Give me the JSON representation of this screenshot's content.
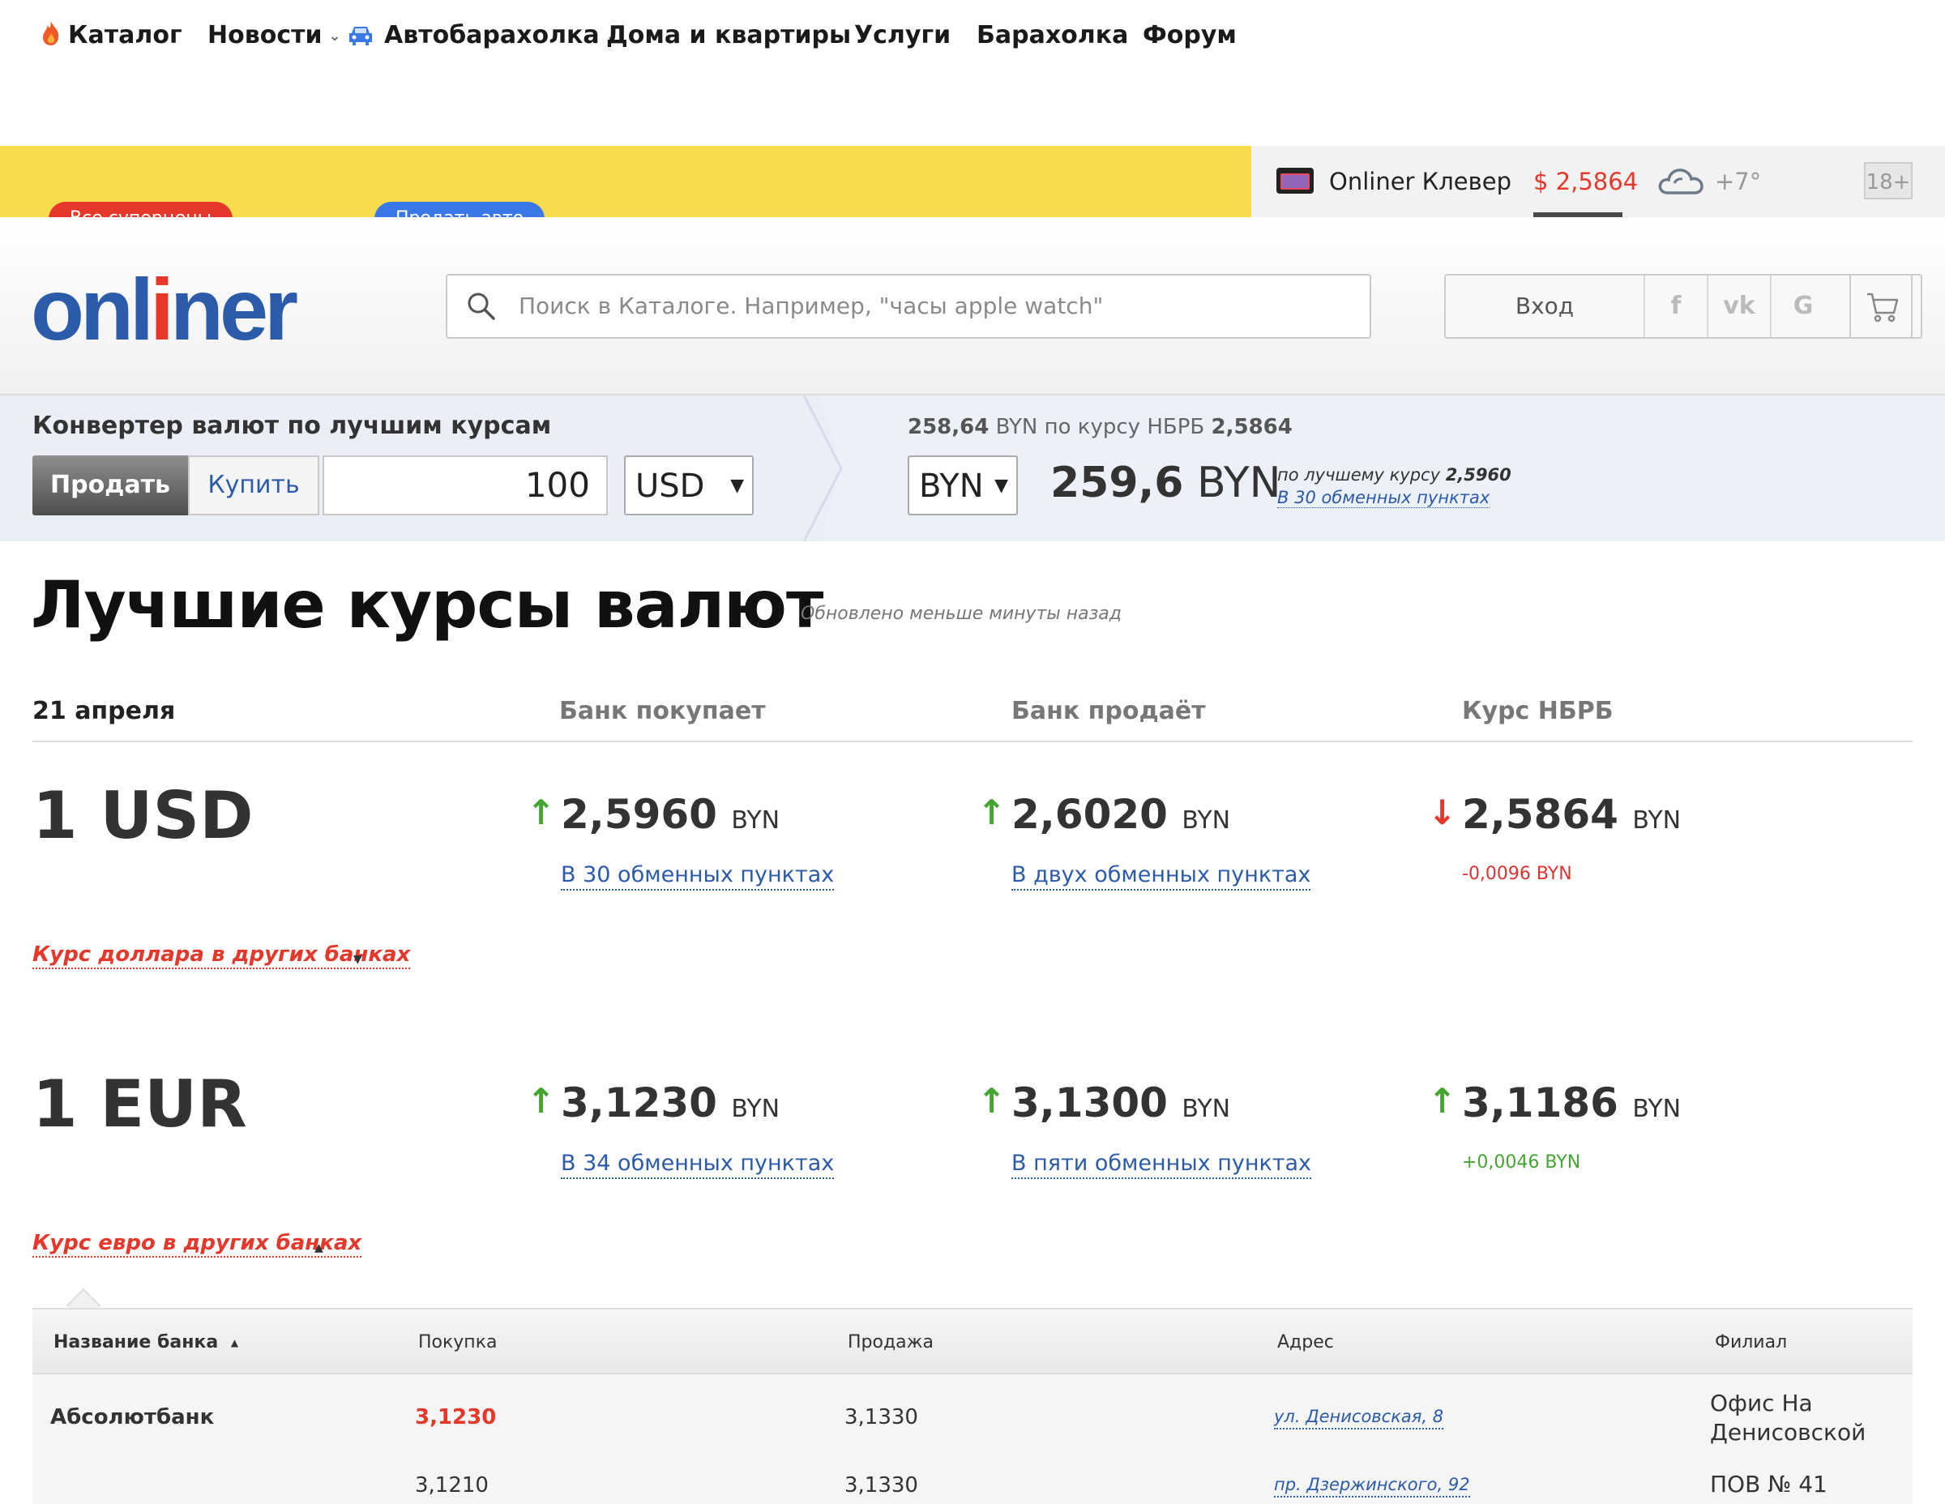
{
  "topnav": {
    "items": [
      {
        "label": "Каталог",
        "icon": "fire-icon"
      },
      {
        "label": "Новости",
        "dropdown": true
      },
      {
        "label": "Автобарахолка",
        "icon": "car-icon",
        "dropdown": true
      },
      {
        "label": "Дома и квартиры",
        "dropdown": true
      },
      {
        "label": "Услуги"
      },
      {
        "label": "Барахолка"
      },
      {
        "label": "Форум"
      }
    ],
    "badges": {
      "catalog": "Все суперцены",
      "auto": "Продать авто"
    },
    "clever": "Onliner Клевер",
    "currency": "$ 2,5864",
    "weather": "+7°",
    "age": "18+",
    "colors": {
      "nav_bg": "#f7dd4d",
      "accent_red": "#e6372b",
      "accent_blue": "#3b78e7"
    }
  },
  "header": {
    "logo_parts": [
      "onl",
      "i",
      "ner"
    ],
    "search_placeholder": "Поиск в Каталоге. Например, \"часы apple watch\"",
    "login": "Вход",
    "social": [
      "f",
      "vk",
      "G"
    ]
  },
  "converter": {
    "title": "Конвертер валют по лучшим курсам",
    "sell": "Продать",
    "buy": "Купить",
    "amount": "100",
    "from_currency": "USD",
    "to_currency": "BYN",
    "nbrb_amount": "258,64",
    "nbrb_text": "BYN по курсу НБРБ",
    "nbrb_rate": "2,5864",
    "result_value": "259,6",
    "result_unit": "BYN",
    "best_text": "по лучшему курсу",
    "best_rate": "2,5960",
    "best_link": "В 30 обменных пунктах"
  },
  "page": {
    "title": "Лучшие курсы валют",
    "updated": "Обновлено меньше минуты назад",
    "date": "21 апреля",
    "col_buy": "Банк покупает",
    "col_sell": "Банк продаёт",
    "col_nbrb": "Курс НБРБ"
  },
  "rates": [
    {
      "currency": "1 USD",
      "buy": {
        "value": "2,5960",
        "unit": "BYN",
        "trend": "up",
        "link": "В 30 обменных пунктах"
      },
      "sell": {
        "value": "2,6020",
        "unit": "BYN",
        "trend": "up",
        "link": "В двух обменных пунктах"
      },
      "nbrb": {
        "value": "2,5864",
        "unit": "BYN",
        "trend": "down",
        "delta": "-0,0096 BYN"
      },
      "banks_link": "Курс доллара в других банках"
    },
    {
      "currency": "1 EUR",
      "buy": {
        "value": "3,1230",
        "unit": "BYN",
        "trend": "up",
        "link": "В 34 обменных пунктах"
      },
      "sell": {
        "value": "3,1300",
        "unit": "BYN",
        "trend": "up",
        "link": "В пяти обменных пунктах"
      },
      "nbrb": {
        "value": "3,1186",
        "unit": "BYN",
        "trend": "up",
        "delta": "+0,0046 BYN"
      },
      "banks_link": "Курс евро в других банках"
    }
  ],
  "table": {
    "headers": [
      "Название банка",
      "Покупка",
      "Продажа",
      "Адрес",
      "Филиал"
    ],
    "rows": [
      {
        "bank": "Абсолютбанк",
        "buy": "3,1230",
        "sell": "3,1330",
        "address": "ул. Денисовская, 8",
        "branch": [
          "Офис На",
          "Денисовской"
        ]
      },
      {
        "bank": "",
        "buy": "3,1210",
        "sell": "3,1330",
        "address": "пр. Дзержинского, 92",
        "branch": [
          "ПОВ № 41"
        ]
      }
    ]
  }
}
